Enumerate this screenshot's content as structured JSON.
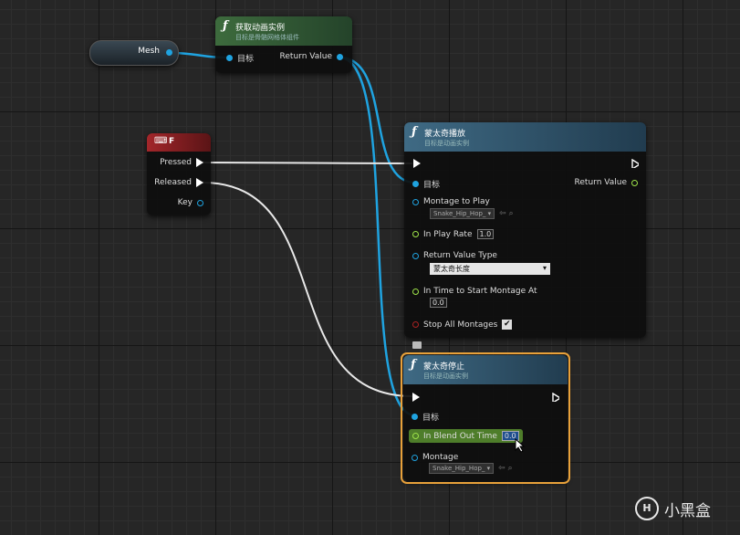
{
  "mesh_node": {
    "label": "Mesh"
  },
  "get_anim_node": {
    "title": "获取动画实例",
    "subtitle": "目标是骨骼网格体组件",
    "in_pin": "目标",
    "out_pin": "Return Value"
  },
  "key_node": {
    "title": "F",
    "pins": [
      "Pressed",
      "Released",
      "Key"
    ]
  },
  "play_node": {
    "title": "蒙太奇播放",
    "subtitle": "目标是动画实例",
    "target": "目标",
    "return_value": "Return Value",
    "montage_label": "Montage to Play",
    "montage_value": "Snake_Hip_Hop_",
    "play_rate_label": "In Play Rate",
    "play_rate_value": "1.0",
    "rv_type_label": "Return Value Type",
    "rv_type_value": "蒙太奇长度",
    "start_label": "In Time to Start Montage At",
    "start_value": "0.0",
    "stop_all_label": "Stop All Montages",
    "stop_all_checked": "✔"
  },
  "stop_node": {
    "title": "蒙太奇停止",
    "subtitle": "目标是动画实例",
    "target": "目标",
    "blend_label": "In Blend Out Time",
    "blend_value": "0.0",
    "montage_label": "Montage",
    "montage_value": "Snake_Hip_Hop_"
  },
  "watermark": {
    "text": "小黑盒"
  },
  "colors": {
    "object_pin": "#1fa3e0",
    "float_pin": "#9ee34a",
    "exec": "#ffffff",
    "selection": "#e8a13a"
  }
}
